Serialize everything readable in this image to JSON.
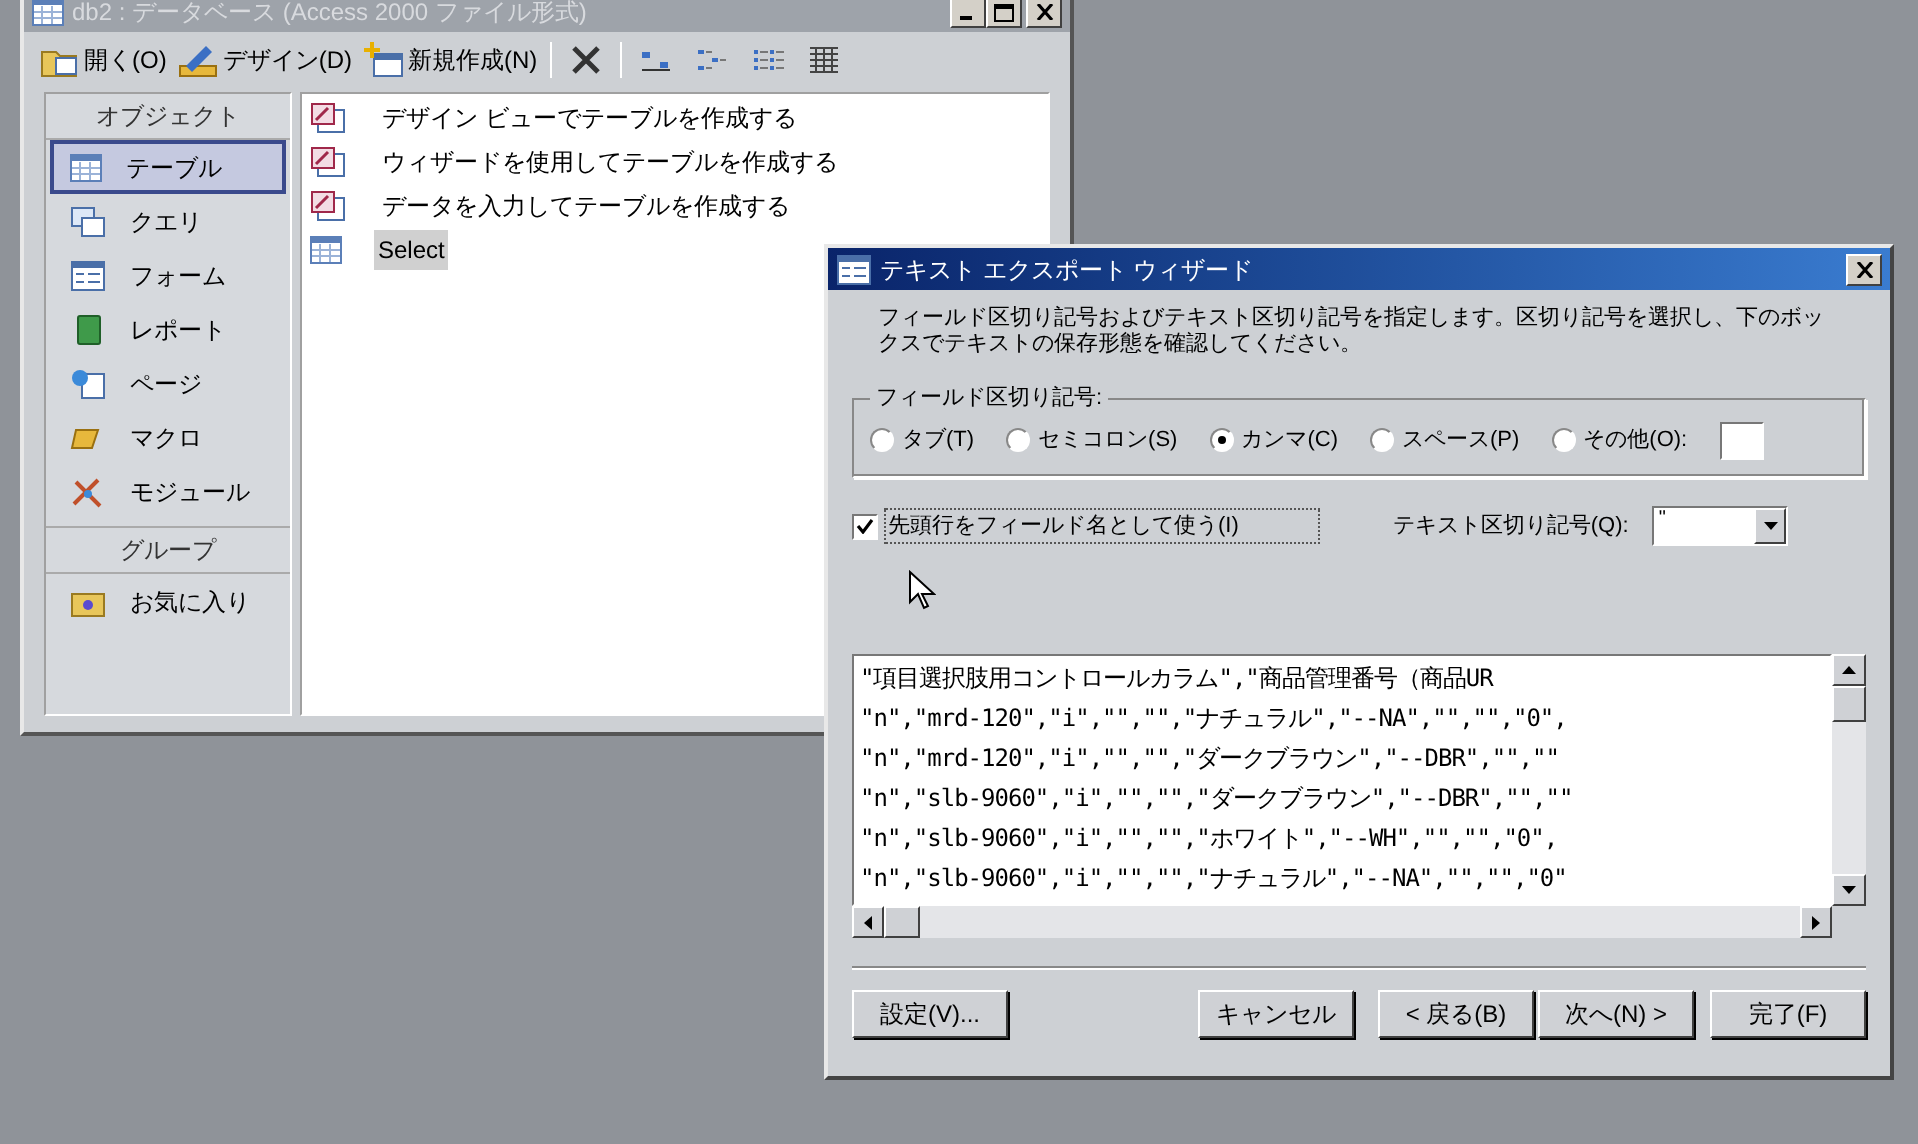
{
  "db_window": {
    "title": "db2 : データベース (Access 2000 ファイル形式)",
    "toolbar": [
      {
        "kind": "open",
        "label": "開く(O)"
      },
      {
        "kind": "design",
        "label": "デザイン(D)"
      },
      {
        "kind": "new",
        "label": "新規作成(N)"
      },
      {
        "kind": "delete"
      },
      {
        "kind": "large_icons"
      },
      {
        "kind": "small_icons"
      },
      {
        "kind": "list"
      },
      {
        "kind": "details"
      }
    ],
    "sidebar": {
      "header": "オブジェクト",
      "items": [
        {
          "kind": "table",
          "label": "テーブル",
          "selected": true
        },
        {
          "kind": "query",
          "label": "クエリ",
          "selected": false
        },
        {
          "kind": "form",
          "label": "フォーム",
          "selected": false
        },
        {
          "kind": "report",
          "label": "レポート",
          "selected": false
        },
        {
          "kind": "page",
          "label": "ページ",
          "selected": false
        },
        {
          "kind": "macro",
          "label": "マクロ",
          "selected": false
        },
        {
          "kind": "module",
          "label": "モジュール",
          "selected": false
        }
      ],
      "group_header": "グループ",
      "group_items": [
        {
          "kind": "favorites",
          "label": "お気に入り",
          "selected": false
        }
      ]
    },
    "list": [
      {
        "kind": "shortcut",
        "label": "デザイン ビューでテーブルを作成する",
        "selected": false
      },
      {
        "kind": "shortcut",
        "label": "ウィザードを使用してテーブルを作成する",
        "selected": false
      },
      {
        "kind": "shortcut",
        "label": "データを入力してテーブルを作成する",
        "selected": false
      },
      {
        "kind": "table",
        "label": "Select",
        "selected": true
      }
    ]
  },
  "wizard": {
    "title": "テキスト エクスポート ウィザード",
    "description": "フィールド区切り記号およびテキスト区切り記号を指定します。区切り記号を選択し、下のボックスでテキストの保存形態を確認してください。",
    "delimiter_group": {
      "label": "フィールド区切り記号:",
      "options": [
        {
          "label": "タブ(T)",
          "selected": false
        },
        {
          "label": "セミコロン(S)",
          "selected": false
        },
        {
          "label": "カンマ(C)",
          "selected": true
        },
        {
          "label": "スペース(P)",
          "selected": false
        },
        {
          "label": "その他(O):",
          "selected": false
        }
      ]
    },
    "first_row_checkbox": {
      "label": "先頭行をフィールド名として使う(I)",
      "checked": true
    },
    "text_qualifier": {
      "label": "テキスト区切り記号(Q):",
      "value": "\""
    },
    "preview_rows": [
      "\"項目選択肢用コントロールカラム\",\"商品管理番号（商品UR",
      "\"n\",\"mrd-120\",\"i\",\"\",\"\",\"ナチュラル\",\"--NA\",\"\",\"\",\"0\",",
      "\"n\",\"mrd-120\",\"i\",\"\",\"\",\"ダークブラウン\",\"--DBR\",\"\",\"\"",
      "\"n\",\"slb-9060\",\"i\",\"\",\"\",\"ダークブラウン\",\"--DBR\",\"\",\"\"",
      "\"n\",\"slb-9060\",\"i\",\"\",\"\",\"ホワイト\",\"--WH\",\"\",\"\",\"0\",",
      "\"n\",\"slb-9060\",\"i\",\"\",\"\",\"ナチュラル\",\"--NA\",\"\",\"\",\"0\""
    ],
    "settings_button": "設定(V)...",
    "buttons": [
      {
        "label": "キャンセル"
      },
      {
        "label": "< 戻る(B)"
      },
      {
        "label": "次へ(N) >"
      },
      {
        "label": "完了(F)"
      }
    ]
  }
}
